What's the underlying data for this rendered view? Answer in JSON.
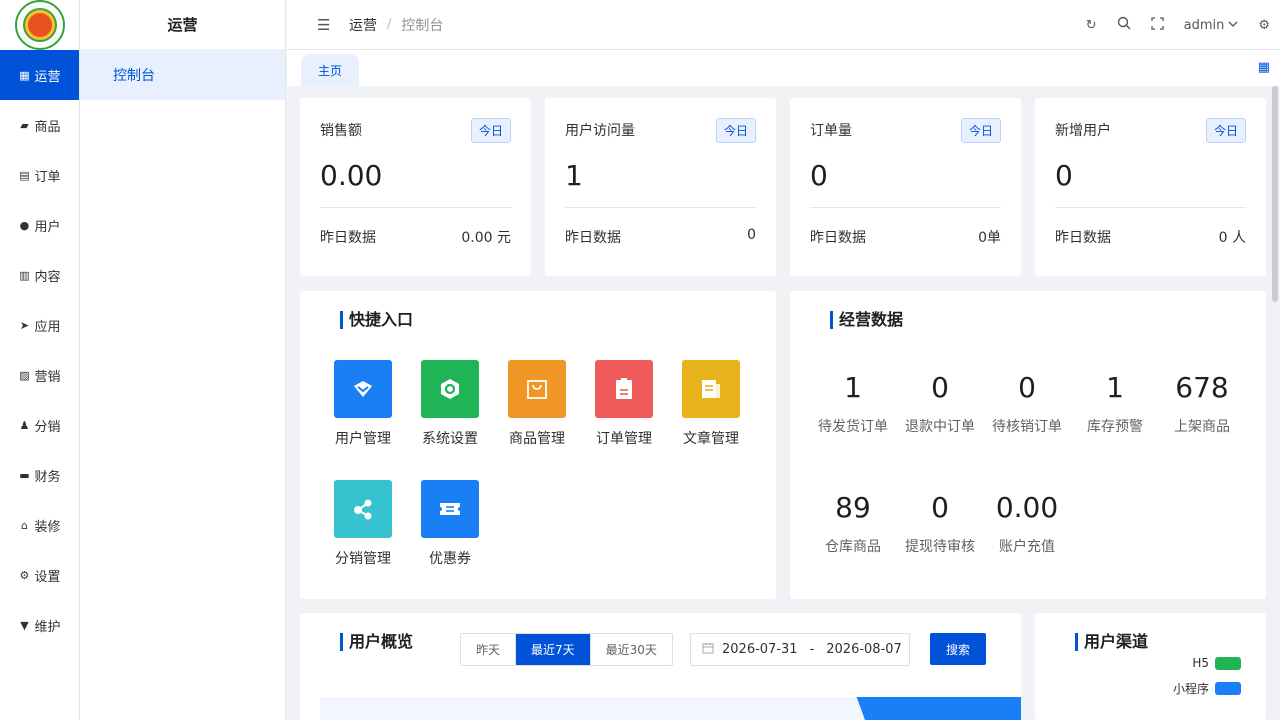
{
  "colors": {
    "accent": "#0052d9",
    "green": "#21b457",
    "blue": "#1a7ef5"
  },
  "primary_nav": [
    {
      "label": "运营",
      "icon": "grid-icon",
      "glyph": "▦",
      "active": true
    },
    {
      "label": "商品",
      "icon": "bag-icon",
      "glyph": "▰"
    },
    {
      "label": "订单",
      "icon": "clipboard-icon",
      "glyph": "▤"
    },
    {
      "label": "用户",
      "icon": "user-icon",
      "glyph": "●"
    },
    {
      "label": "内容",
      "icon": "book-icon",
      "glyph": "▥"
    },
    {
      "label": "应用",
      "icon": "send-icon",
      "glyph": "➤"
    },
    {
      "label": "营销",
      "icon": "chart-icon",
      "glyph": "▨"
    },
    {
      "label": "分销",
      "icon": "person-icon",
      "glyph": "♟"
    },
    {
      "label": "财务",
      "icon": "wallet-icon",
      "glyph": "▬"
    },
    {
      "label": "装修",
      "icon": "home-icon",
      "glyph": "⌂"
    },
    {
      "label": "设置",
      "icon": "gear-icon",
      "glyph": "⚙"
    },
    {
      "label": "维护",
      "icon": "tool-icon",
      "glyph": "▼"
    }
  ],
  "secondary_nav": {
    "title": "运营",
    "items": [
      "控制台"
    ]
  },
  "header": {
    "crumb_parent": "运营",
    "crumb_sep": "/",
    "crumb_current": "控制台",
    "user": "admin"
  },
  "tabs": [
    "主页"
  ],
  "stats": [
    {
      "title": "销售额",
      "badge": "今日",
      "value": "0.00",
      "foot_label": "昨日数据",
      "foot_value": "0.00 元"
    },
    {
      "title": "用户访问量",
      "badge": "今日",
      "value": "1",
      "foot_label": "昨日数据",
      "foot_value": "0"
    },
    {
      "title": "订单量",
      "badge": "今日",
      "value": "0",
      "foot_label": "昨日数据",
      "foot_value": "0单"
    },
    {
      "title": "新增用户",
      "badge": "今日",
      "value": "0",
      "foot_label": "昨日数据",
      "foot_value": "0 人"
    }
  ],
  "quick": {
    "title": "快捷入口",
    "items": [
      {
        "label": "用户管理",
        "icon": "user-manage-icon",
        "color": "#1a7ef5"
      },
      {
        "label": "系统设置",
        "icon": "settings-icon",
        "color": "#21b457"
      },
      {
        "label": "商品管理",
        "icon": "shopping-bag-icon",
        "color": "#ef9627"
      },
      {
        "label": "订单管理",
        "icon": "order-icon",
        "color": "#ef5b5b"
      },
      {
        "label": "文章管理",
        "icon": "article-icon",
        "color": "#e8b21b"
      },
      {
        "label": "分销管理",
        "icon": "share-icon",
        "color": "#36c2cf"
      },
      {
        "label": "优惠券",
        "icon": "coupon-icon",
        "color": "#1a7ef5"
      }
    ]
  },
  "business": {
    "title": "经营数据",
    "items": [
      {
        "value": "1",
        "label": "待发货订单"
      },
      {
        "value": "0",
        "label": "退款中订单"
      },
      {
        "value": "0",
        "label": "待核销订单"
      },
      {
        "value": "1",
        "label": "库存预警"
      },
      {
        "value": "678",
        "label": "上架商品"
      },
      {
        "value": "89",
        "label": "仓库商品"
      },
      {
        "value": "0",
        "label": "提现待审核"
      },
      {
        "value": "0.00",
        "label": "账户充值"
      }
    ]
  },
  "overview": {
    "title": "用户概览",
    "ranges": [
      "昨天",
      "最近7天",
      "最近30天"
    ],
    "active_range": "最近7天",
    "date_start": "2026-07-31",
    "date_sep": "-",
    "date_end": "2026-08-07",
    "search_label": "搜索"
  },
  "channels": {
    "title": "用户渠道",
    "legend": [
      {
        "label": "H5",
        "color": "#21b457"
      },
      {
        "label": "小程序",
        "color": "#1a7ef5"
      }
    ]
  }
}
